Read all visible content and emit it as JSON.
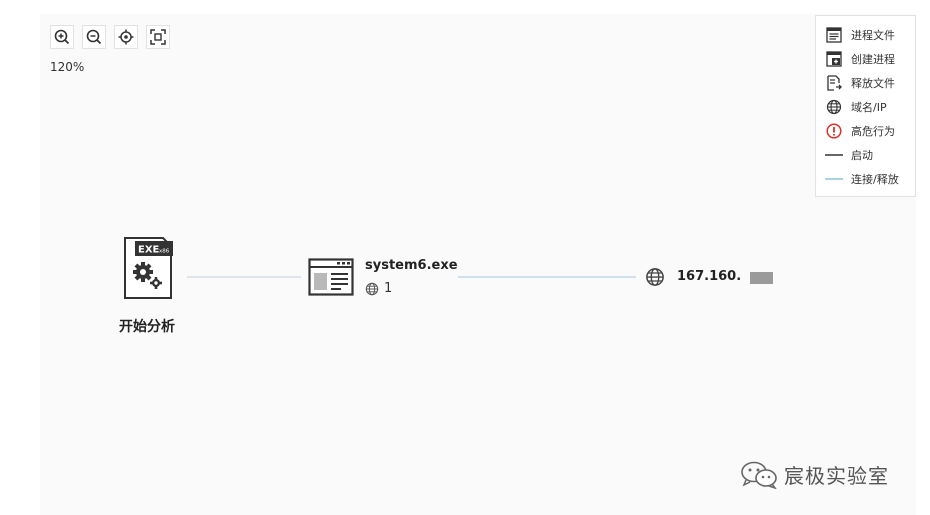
{
  "toolbar": {
    "zoom_level": "120%",
    "buttons": [
      {
        "name": "zoom-in",
        "icon": "zoom-in-icon"
      },
      {
        "name": "zoom-out",
        "icon": "zoom-out-icon"
      },
      {
        "name": "locate",
        "icon": "crosshair-icon"
      },
      {
        "name": "fit-view",
        "icon": "fit-screen-icon"
      }
    ]
  },
  "legend": {
    "items": [
      {
        "label": "进程文件",
        "icon": "process-file-icon"
      },
      {
        "label": "创建进程",
        "icon": "create-process-icon"
      },
      {
        "label": "释放文件",
        "icon": "release-file-icon"
      },
      {
        "label": "域名/IP",
        "icon": "globe-icon"
      },
      {
        "label": "高危行为",
        "icon": "alert-icon"
      },
      {
        "label": "启动",
        "icon": "dark-line-icon"
      },
      {
        "label": "连接/释放",
        "icon": "light-line-icon"
      }
    ]
  },
  "graph": {
    "root": {
      "label": "开始分析",
      "badge": "EXE",
      "badge_sub": "x86",
      "icon": "exe-file-gear-icon"
    },
    "process": {
      "name": "system6.exe",
      "connection_count": "1",
      "icon": "window-process-icon"
    },
    "ip": {
      "label": "167.160.",
      "icon": "globe-icon"
    }
  },
  "watermark": {
    "text": "宸极实验室",
    "icon": "wechat-icon"
  },
  "colors": {
    "canvas_bg": "#fafafa",
    "start_edge": "#dfe4ea",
    "connect_edge": "#cfe0ee",
    "alert_red": "#d9342b",
    "icon_dark": "#333333"
  }
}
